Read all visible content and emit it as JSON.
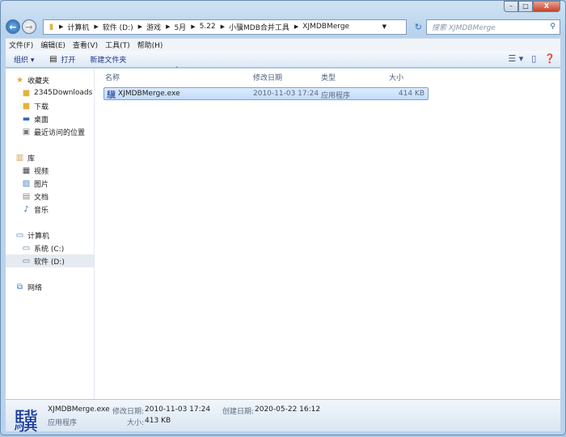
{
  "address": {
    "crumbs": [
      "计算机",
      "软件 (D:)",
      "游戏",
      "5月",
      "5.22",
      "小骥MDB合并工具",
      "XJMDBMerge"
    ]
  },
  "search": {
    "placeholder": "搜索 XJMDBMerge"
  },
  "menu": [
    "文件(F)",
    "编辑(E)",
    "查看(V)",
    "工具(T)",
    "帮助(H)"
  ],
  "toolbar": {
    "organize": "组织 ▾",
    "open": "打开",
    "new_folder": "新建文件夹"
  },
  "sidebar": {
    "favorites": {
      "label": "收藏夹",
      "items": [
        "2345Downloads",
        "下载",
        "桌面",
        "最近访问的位置"
      ]
    },
    "libraries": {
      "label": "库",
      "items": [
        "视频",
        "图片",
        "文档",
        "音乐"
      ]
    },
    "computer": {
      "label": "计算机",
      "items": [
        "系统 (C:)",
        "软件 (D:)"
      ]
    },
    "network": {
      "label": "网络"
    }
  },
  "columns": {
    "name": "名称",
    "modified": "修改日期",
    "type": "类型",
    "size": "大小"
  },
  "files": [
    {
      "name": "XJMDBMerge.exe",
      "modified": "2010-11-03 17:24",
      "type": "应用程序",
      "size": "414 KB"
    }
  ],
  "status": {
    "icon_glyph": "驥",
    "name": "XJMDBMerge.exe",
    "type": "应用程序",
    "modified_label": "修改日期:",
    "modified": "2010-11-03 17:24",
    "created_label": "创建日期:",
    "created": "2020-05-22 16:12",
    "size_label": "大小:",
    "size": "413 KB"
  }
}
